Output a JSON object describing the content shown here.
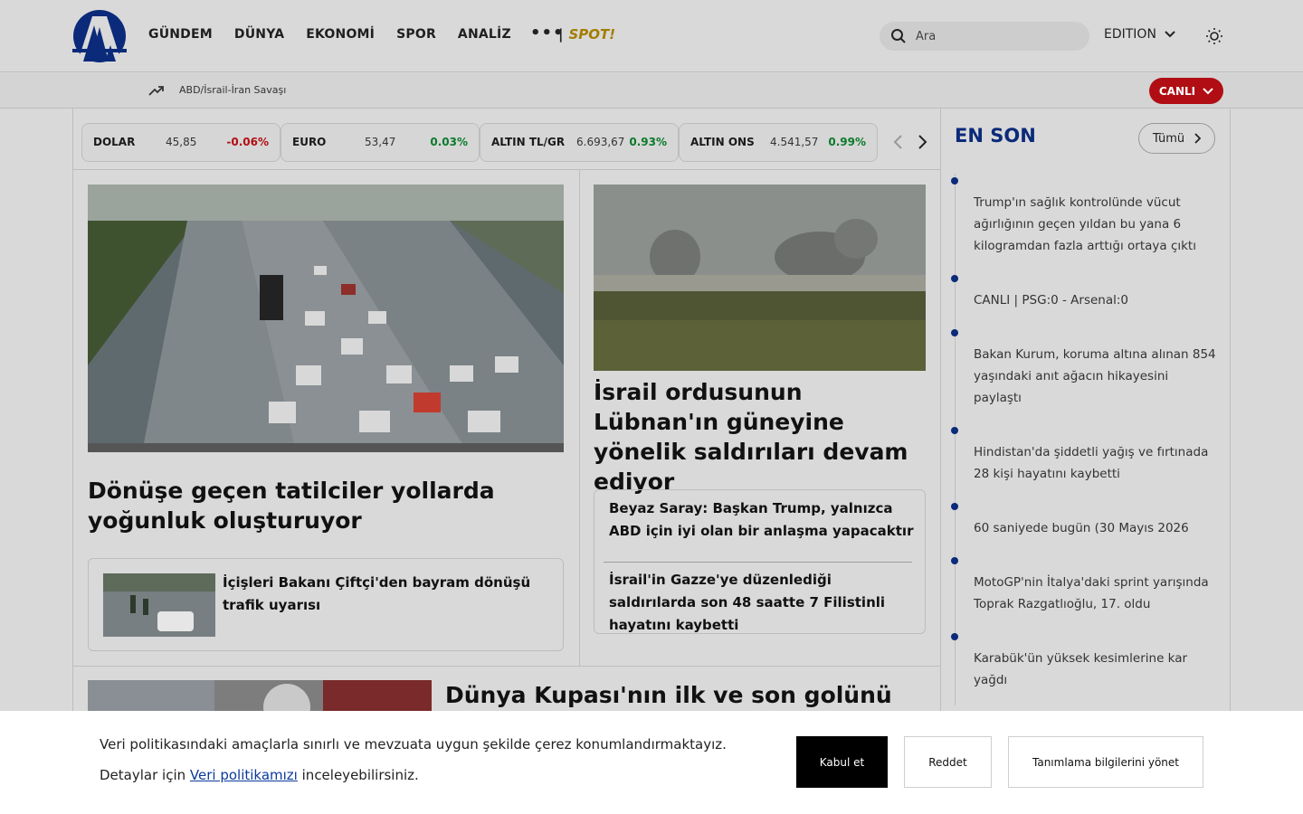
{
  "header": {
    "nav": [
      "GÜNDEM",
      "DÜNYA",
      "EKONOMİ",
      "SPOR",
      "ANALİZ"
    ],
    "more": "•••",
    "spot_sep": "|",
    "spot_label": "SPOT!",
    "search_placeholder": "Ara",
    "edition_label": "EDITION",
    "icons": {
      "search": "search-icon",
      "theme": "sun-icon",
      "dropdown": "chevron-down-icon"
    }
  },
  "subbar": {
    "trend_text": "ABD/İsrail-İran Savaşı",
    "live_label": "CANLI"
  },
  "ticker": [
    {
      "name": "DOLAR",
      "value": "45,85",
      "change": "-0.06%",
      "direction": "neg"
    },
    {
      "name": "EURO",
      "value": "53,47",
      "change": "0.03%",
      "direction": "pos"
    },
    {
      "name": "ALTIN TL/GR",
      "value": "6.693,67",
      "change": "0.93%",
      "direction": "pos"
    },
    {
      "name": "ALTIN ONS",
      "value": "4.541,57",
      "change": "0.99%",
      "direction": "pos"
    }
  ],
  "main": {
    "lead_headline": "Dönüşe geçen tatilciler yollarda yoğunluk oluşturuyor",
    "lead_sub": "İçişleri Bakanı Çiftçi'den bayram dönüşü trafik uyarısı",
    "second_headline": "İsrail ordusunun Lübnan'ın güneyine yönelik saldırıları devam ediyor",
    "second_sub_1": "Beyaz Saray: Başkan Trump, yalnızca ABD için iyi olan bir anlaşma yapacaktır",
    "second_sub_2": "İsrail'in Gazze'ye düzenlediği saldırılarda son 48 saatte 7 Filistinli hayatını kaybetti",
    "third_headline": "Dünya Kupası'nın ilk ve son golünü"
  },
  "sidebar": {
    "title": "EN SON",
    "all_label": "Tümü",
    "items": [
      "Trump'ın sağlık kontrolünde vücut ağırlığının geçen yıldan bu yana 6 kilogramdan fazla arttığı ortaya çıktı",
      "CANLI | PSG:0 - Arsenal:0",
      "Bakan Kurum, koruma altına alınan 854 yaşındaki anıt ağacın hikayesini paylaştı",
      "Hindistan'da şiddetli yağış ve fırtınada 28 kişi hayatını kaybetti",
      "60 saniyede bugün (30 Mayıs 2026",
      "MotoGP'nin İtalya'daki sprint yarışında Toprak Razgatlıoğlu, 17. oldu",
      "Karabük'ün yüksek kesimlerine kar yağdı"
    ]
  },
  "cookie": {
    "line1": "Veri politikasındaki amaçlarla sınırlı ve mevzuata uygun şekilde çerez konumlandırmaktayız.",
    "line2_pre": "Detaylar için",
    "line2_link": "Veri politikamızı",
    "line2_post": "inceleyebilirsiniz.",
    "accept": "Kabul et",
    "reject": "Reddet",
    "manage": "Tanımlama bilgilerini yönet"
  },
  "colors": {
    "brand_blue": "#0b2a7a",
    "live_red": "#b00e14",
    "negative": "#b10d12",
    "positive": "#0a7a2a"
  }
}
